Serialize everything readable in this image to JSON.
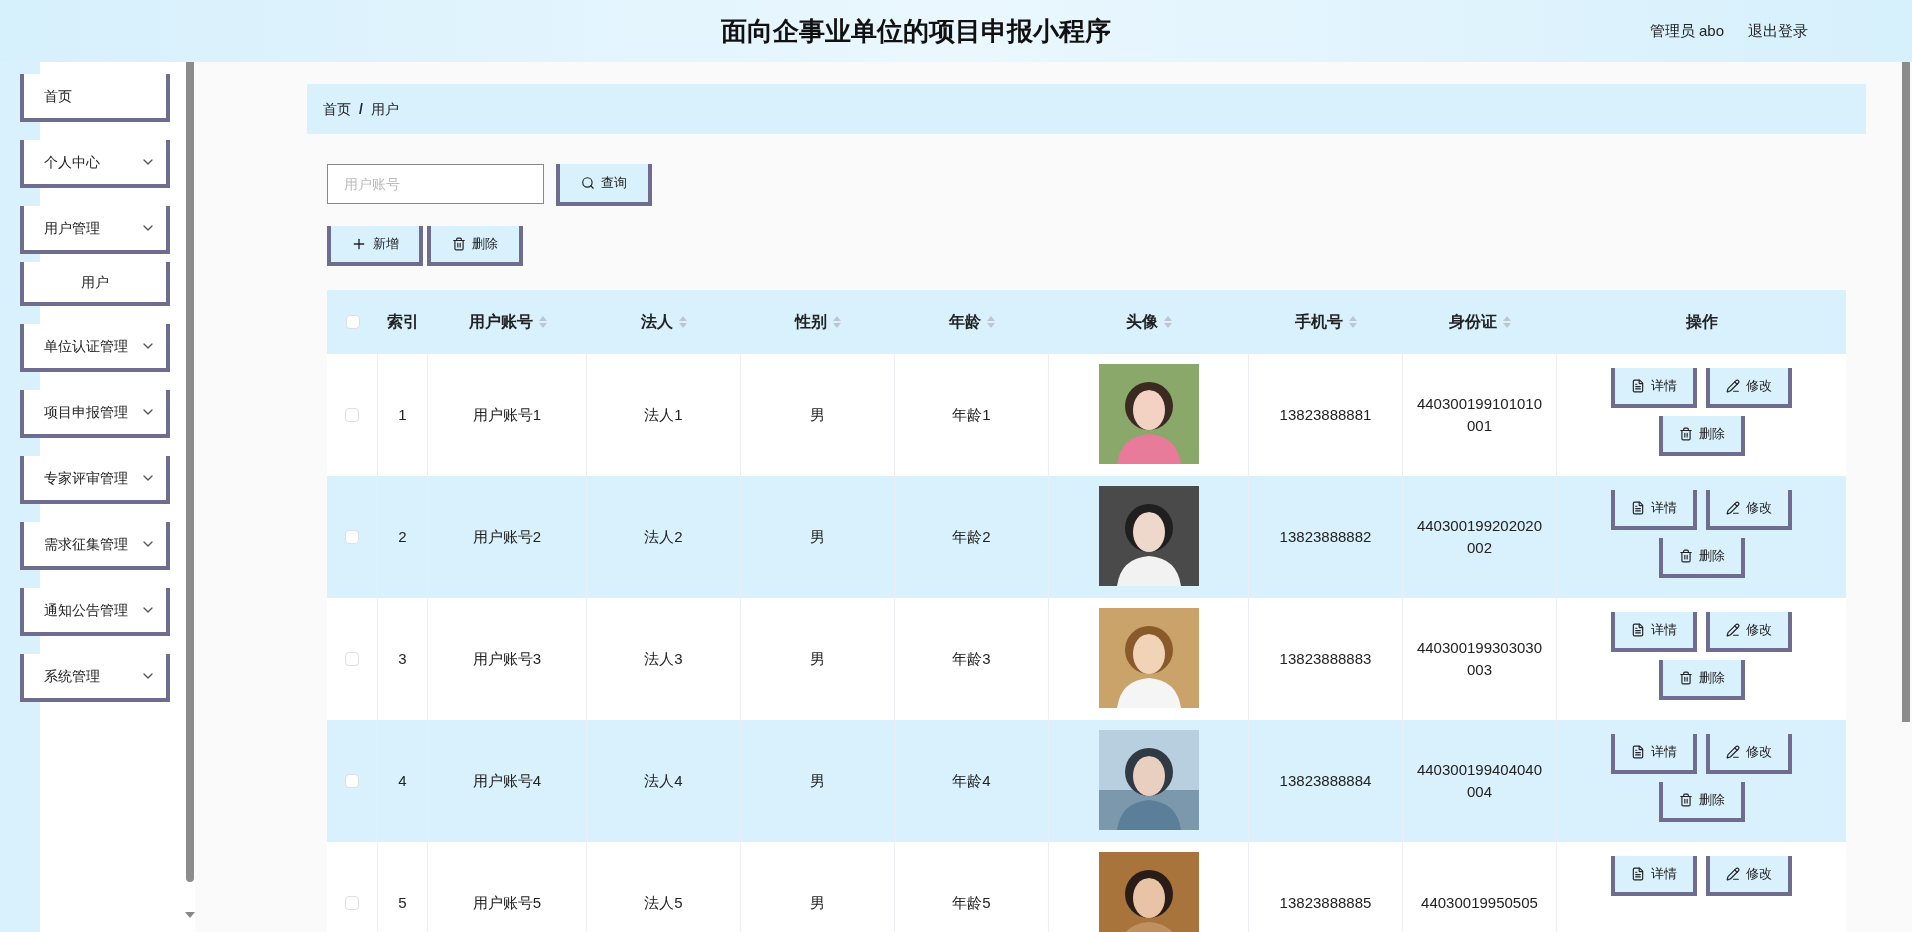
{
  "header": {
    "title": "面向企事业单位的项目申报小程序",
    "user": "管理员 abo",
    "logout": "退出登录"
  },
  "sidebar": {
    "items": [
      {
        "kind": "link",
        "label": "首页"
      },
      {
        "kind": "menu",
        "label": "个人中心"
      },
      {
        "kind": "menu",
        "label": "用户管理",
        "children": [
          {
            "label": "用户"
          }
        ]
      },
      {
        "kind": "menu",
        "label": "单位认证管理"
      },
      {
        "kind": "menu",
        "label": "项目申报管理"
      },
      {
        "kind": "menu",
        "label": "专家评审管理"
      },
      {
        "kind": "menu",
        "label": "需求征集管理"
      },
      {
        "kind": "menu",
        "label": "通知公告管理"
      },
      {
        "kind": "menu",
        "label": "系统管理"
      }
    ]
  },
  "breadcrumb": {
    "items": [
      "首页",
      "用户"
    ],
    "separator": "/"
  },
  "search": {
    "placeholder": "用户账号",
    "button": "查询"
  },
  "toolbar": [
    {
      "kind": "add",
      "label": "新增"
    },
    {
      "kind": "delete",
      "label": "删除"
    }
  ],
  "table": {
    "select_all": {
      "checked": false
    },
    "columns": [
      {
        "label": "索引",
        "sortable": false
      },
      {
        "label": "用户账号",
        "sortable": true
      },
      {
        "label": "法人",
        "sortable": true
      },
      {
        "label": "性别",
        "sortable": true
      },
      {
        "label": "年龄",
        "sortable": true
      },
      {
        "label": "头像",
        "sortable": true
      },
      {
        "label": "手机号",
        "sortable": true
      },
      {
        "label": "身份证",
        "sortable": true
      },
      {
        "label": "操作",
        "sortable": false
      }
    ],
    "rows": [
      {
        "checked": false,
        "cells": [
          "1",
          "用户账号1",
          "法人1",
          "男",
          "年龄1"
        ],
        "phone": "13823888881",
        "id_card": "440300199101010001",
        "actions": [
          {
            "kind": "detail",
            "label": "详情"
          },
          {
            "kind": "edit",
            "label": "修改"
          },
          {
            "kind": "delete",
            "label": "删除"
          }
        ]
      },
      {
        "checked": false,
        "cells": [
          "2",
          "用户账号2",
          "法人2",
          "男",
          "年龄2"
        ],
        "phone": "13823888882",
        "id_card": "440300199202020002",
        "actions": [
          {
            "kind": "detail",
            "label": "详情"
          },
          {
            "kind": "edit",
            "label": "修改"
          },
          {
            "kind": "delete",
            "label": "删除"
          }
        ]
      },
      {
        "checked": false,
        "cells": [
          "3",
          "用户账号3",
          "法人3",
          "男",
          "年龄3"
        ],
        "phone": "13823888883",
        "id_card": "440300199303030003",
        "actions": [
          {
            "kind": "detail",
            "label": "详情"
          },
          {
            "kind": "edit",
            "label": "修改"
          },
          {
            "kind": "delete",
            "label": "删除"
          }
        ]
      },
      {
        "checked": false,
        "cells": [
          "4",
          "用户账号4",
          "法人4",
          "男",
          "年龄4"
        ],
        "phone": "13823888884",
        "id_card": "440300199404040004",
        "actions": [
          {
            "kind": "detail",
            "label": "详情"
          },
          {
            "kind": "edit",
            "label": "修改"
          },
          {
            "kind": "delete",
            "label": "删除"
          }
        ]
      },
      {
        "checked": false,
        "cells": [
          "5",
          "用户账号5",
          "法人5",
          "男",
          "年龄5"
        ],
        "phone": "13823888885",
        "id_card": "44030019950505",
        "actions": [
          {
            "kind": "detail",
            "label": "详情"
          },
          {
            "kind": "edit",
            "label": "修改"
          }
        ]
      }
    ]
  }
}
